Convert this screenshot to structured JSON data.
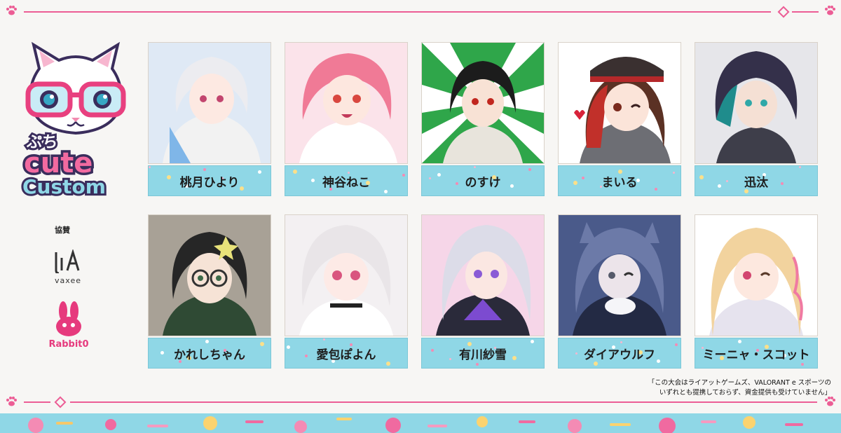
{
  "logo": {
    "line1": "ぷち",
    "line2": "cute",
    "line3": "Custom"
  },
  "sponsor": {
    "label": "協賛",
    "brand1": "vaxee",
    "brand2": "Rabbit0"
  },
  "players": [
    {
      "name": "桃月ひより"
    },
    {
      "name": "神谷ねこ"
    },
    {
      "name": "のすけ"
    },
    {
      "name": "まいる"
    },
    {
      "name": "迅汰"
    },
    {
      "name": "かれしちゃん"
    },
    {
      "name": "愛包ぽよん"
    },
    {
      "name": "有川紗雪"
    },
    {
      "name": "ダイアウルフ"
    },
    {
      "name": "ミーニャ・スコット"
    }
  ],
  "disclaimer": {
    "line1": "「この大会はライアットゲームズ、VALORANT e スポーツの",
    "line2": "いずれとも提携しておらず、資金提供も受けていません」"
  },
  "colors": {
    "pink": "#ec5d95",
    "cyan": "#8fd7e6",
    "background": "#f7f6f4"
  },
  "icons": [
    "paw-icon",
    "cat-glasses-logo",
    "vaxee-logo",
    "rabbit-logo",
    "candy-pattern"
  ]
}
